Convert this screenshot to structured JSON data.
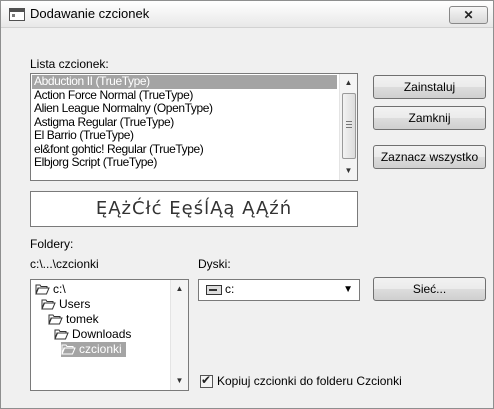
{
  "window": {
    "title": "Dodawanie czcionek",
    "close_label": "✕"
  },
  "font_list": {
    "label": "Lista czcionek:",
    "items": [
      "Abduction II (TrueType)",
      "Action Force Normal (TrueType)",
      "Alien League Normalny (OpenType)",
      "Astigma Regular (TrueType)",
      "El Barrio (TrueType)",
      "el&font gohtic! Regular (TrueType)",
      "Elbjorg Script (TrueType)"
    ],
    "selected_index": 0
  },
  "buttons": {
    "install": "Zainstaluj",
    "close": "Zamknij",
    "select_all": "Zaznacz wszystko",
    "network": "Sieć..."
  },
  "preview": {
    "text": "ĘĄżĆłć ĘęśĺĄą ĄĄźń"
  },
  "folders": {
    "label": "Foldery:",
    "current_path": "c:\\...\\czcionki",
    "items": [
      {
        "name": "c:\\",
        "level": 0
      },
      {
        "name": "Users",
        "level": 1
      },
      {
        "name": "tomek",
        "level": 2
      },
      {
        "name": "Downloads",
        "level": 3
      },
      {
        "name": "czcionki",
        "level": 4
      }
    ],
    "selected_index": 4
  },
  "drives": {
    "label": "Dyski:",
    "selected": "c:"
  },
  "copy_option": {
    "label": "Kopiuj czcionki do folderu Czcionki",
    "checked": true
  }
}
